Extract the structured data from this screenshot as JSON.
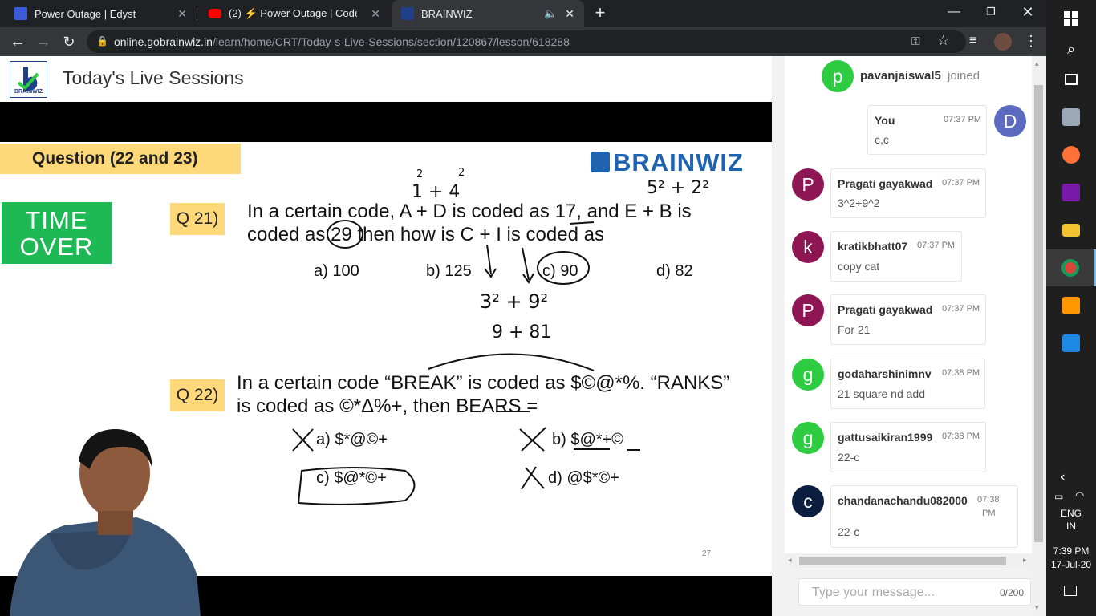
{
  "browser": {
    "tabs": [
      {
        "title": "Power Outage | Edyst",
        "active": false
      },
      {
        "title": "(2) ⚡ Power Outage | CodeVita",
        "active": false
      },
      {
        "title": "BRAINWIZ",
        "active": true
      }
    ],
    "url_host": "online.gobrainwiz.in",
    "url_path": "/learn/home/CRT/Today-s-Live-Sessions/section/120867/lesson/618288"
  },
  "page": {
    "logo_text": "BRAINWIZ",
    "title": "Today's Live Sessions"
  },
  "slide": {
    "header": "Question (22 and 23)",
    "brand": "BRAINWIZ",
    "time_over_line1": "TIME",
    "time_over_line2": "OVER",
    "q21": {
      "tag": "Q 21)",
      "line1": "In a certain code, A + D is coded as 17, and E + B is",
      "line2": "coded as 29 then how is C + I is coded as",
      "options": [
        "a) 100",
        "b) 125",
        "c) 90",
        "d) 82"
      ]
    },
    "q22": {
      "tag": "Q 22)",
      "line1": "In a certain code “BREAK” is coded as $©@*%. “RANKS”",
      "line2": "is coded as ©*Δ%+, then BEARS =",
      "options": [
        "a)   $*@©+",
        "b) $@*+©",
        "c)   $@*©+",
        "d) @$*©+"
      ]
    },
    "annotations": {
      "a1": "2",
      "a2": "2",
      "a3": "1 + 4",
      "a4": "5² + 2²",
      "a5": "3² + 9²",
      "a6": "9 + 81"
    },
    "page_number": "27"
  },
  "chat": {
    "join_initial": "p",
    "join_user": "pavanjaiswal5",
    "join_text": "joined",
    "messages": [
      {
        "initial": "D",
        "name": "You",
        "time": "07:37 PM",
        "text": "c,c",
        "color": "#5c6bc0"
      },
      {
        "initial": "P",
        "name": "Pragati gayakwad",
        "time": "07:37 PM",
        "text": "3^2+9^2",
        "color": "#8e1654"
      },
      {
        "initial": "k",
        "name": "kratikbhatt07",
        "time": "07:37 PM",
        "text": "copy cat",
        "color": "#8e1654"
      },
      {
        "initial": "P",
        "name": "Pragati gayakwad",
        "time": "07:37 PM",
        "text": "For 21",
        "color": "#8e1654"
      },
      {
        "initial": "g",
        "name": "godaharshinimnv",
        "time": "07:38 PM",
        "text": "21 square nd add",
        "color": "#2ecc40"
      },
      {
        "initial": "g",
        "name": "gattusaikiran1999",
        "time": "07:38 PM",
        "text": "22-c",
        "color": "#2ecc40"
      },
      {
        "initial": "c",
        "name": "chandanachandu082000",
        "time_a": "07:38",
        "time_b": "PM",
        "text": "22-c",
        "color": "#0b1e3f"
      }
    ],
    "input_placeholder": "Type your message...",
    "char_count": "0/200"
  },
  "taskbar": {
    "lang1": "ENG",
    "lang2": "IN",
    "time": "7:39 PM",
    "date": "17-Jul-20"
  }
}
